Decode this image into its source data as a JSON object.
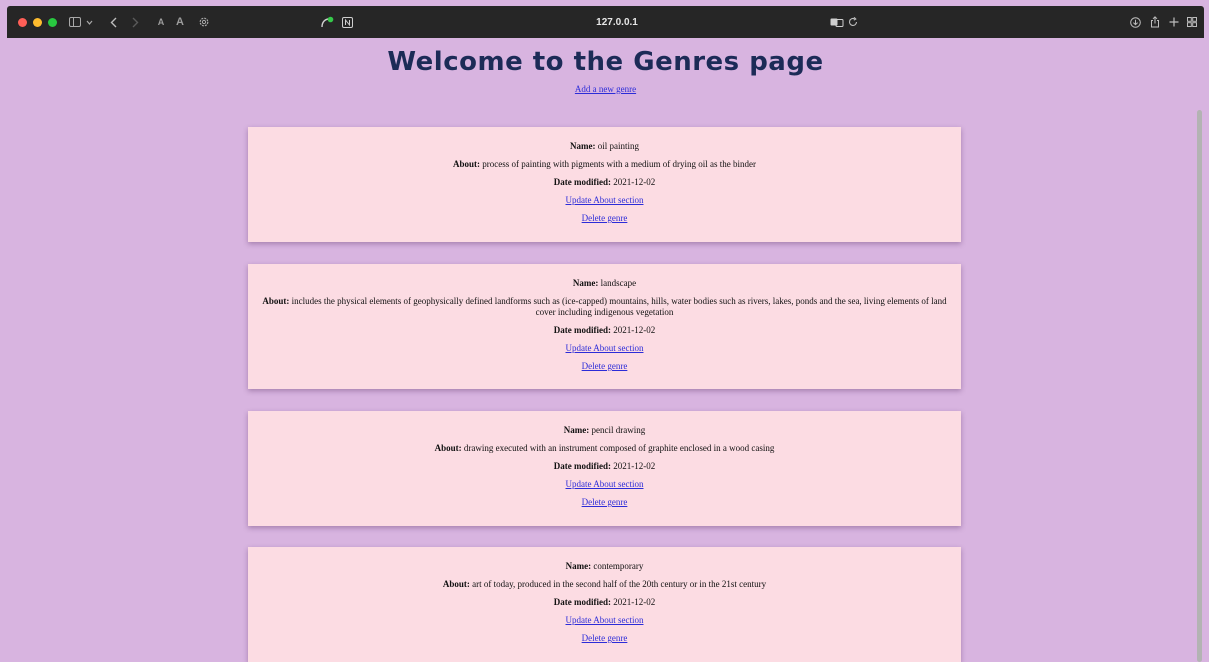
{
  "browser": {
    "url": "127.0.0.1",
    "text_size_small": "A",
    "text_size_large": "A"
  },
  "page": {
    "title": "Welcome to the Genres page",
    "add_link": "Add a new genre"
  },
  "labels": {
    "name": "Name:",
    "about": "About:",
    "date": "Date modified:"
  },
  "genres": [
    {
      "name": "oil painting",
      "about": "process of painting with pigments with a medium of drying oil as the binder",
      "date": "2021-12-02",
      "update_label": "Update About section",
      "delete_label": "Delete genre"
    },
    {
      "name": "landscape",
      "about": "includes the physical elements of geophysically defined landforms such as (ice-capped) mountains, hills, water bodies such as rivers, lakes, ponds and the sea, living elements of land cover including indigenous vegetation",
      "date": "2021-12-02",
      "update_label": "Update About section",
      "delete_label": "Delete genre"
    },
    {
      "name": "pencil drawing",
      "about": "drawing executed with an instrument composed of graphite enclosed in a wood casing",
      "date": "2021-12-02",
      "update_label": "Update About section",
      "delete_label": "Delete genre"
    },
    {
      "name": "contemporary",
      "about": "art of today, produced in the second half of the 20th century or in the 21st century",
      "date": "2021-12-02",
      "update_label": "Update About section",
      "delete_label": "Delete genre"
    }
  ],
  "colors": {
    "page_background": "#d8b4e0",
    "card_background": "#fcdce3",
    "title": "#1c2b57",
    "link": "#2c2cd8"
  }
}
